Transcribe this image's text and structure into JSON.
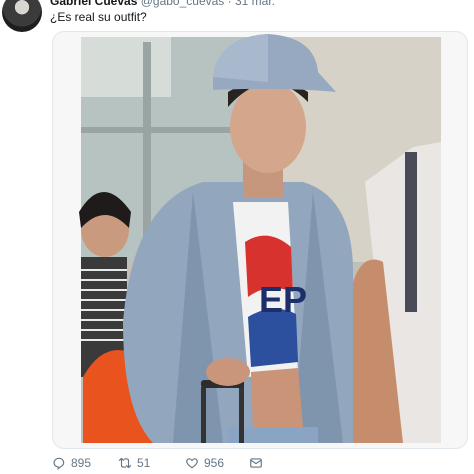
{
  "tweet": {
    "author_name": "Gabriel Cuevas",
    "author_handle": "@gabo_cuevas",
    "separator": "·",
    "date": "31 mar.",
    "text": "¿Es real su outfit?"
  },
  "media": {
    "shirt_text": "EP"
  },
  "actions": {
    "reply_count": "895",
    "retweet_count": "51",
    "like_count": "956"
  },
  "icons": [
    "reply-icon",
    "retweet-icon",
    "like-icon",
    "message-icon"
  ],
  "colors": {
    "text": "#14171a",
    "secondary": "#657786",
    "border": "#e1e8ed"
  }
}
